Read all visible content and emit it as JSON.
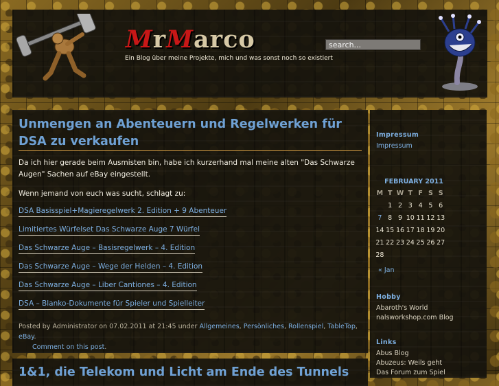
{
  "header": {
    "title_caps": [
      "M",
      "r",
      "M",
      "arco"
    ],
    "tagline": "Ein Blog über meine Projekte, mich und was sonst noch so existiert",
    "search_value": "search..."
  },
  "post": {
    "title": "Unmengen an Abenteuern und Regelwerken für DSA zu verkaufen",
    "intro": "Da ich hier gerade beim Ausmisten bin, habe ich kurzerhand mal meine alten \"Das Schwarze Augen\" Sachen auf eBay eingestellt.",
    "ask": "Wenn jemand von euch was sucht, schlagt zu:",
    "links": [
      "DSA Basisspiel+Magieregelwerk 2. Edition + 9 Abenteuer",
      "Limitiertes Würfelset Das Schwarze Auge 7 Würfel",
      "Das Schwarze Auge – Basisregelwerk – 4. Edition",
      "Das Schwarze Auge – Wege der Helden – 4. Edition",
      "Das Schwarze Auge – Liber Cantiones – 4. Edition",
      "DSA – Blanko-Dokumente für Spieler und Spielleiter"
    ],
    "meta": {
      "posted_by": "Posted by",
      "author": "Administrator",
      "on": "on",
      "date": "07.02.2011",
      "at": "at",
      "time": "21:45",
      "under": "under",
      "categories": [
        "Allgemeines",
        "Persönliches",
        "Rollenspiel",
        "TableTop",
        "eBay"
      ],
      "comment": "Comment on this post"
    }
  },
  "post2": {
    "title": "1&1, die Telekom und Licht am Ende des Tunnels"
  },
  "sidebar": {
    "impressum_heading": "Impressum",
    "impressum_link": "Impressum",
    "calendar": {
      "caption": "FEBRUARY 2011",
      "weekdays": [
        "M",
        "T",
        "W",
        "T",
        "F",
        "S",
        "S"
      ],
      "rows": [
        [
          "",
          "1",
          "2",
          "3",
          "4",
          "5",
          "6"
        ],
        [
          "7",
          "8",
          "9",
          "10",
          "11",
          "12",
          "13"
        ],
        [
          "14",
          "15",
          "16",
          "17",
          "18",
          "19",
          "20"
        ],
        [
          "21",
          "22",
          "23",
          "24",
          "25",
          "26",
          "27"
        ],
        [
          "28",
          "",
          "",
          "",
          "",
          "",
          ""
        ]
      ],
      "linked_days": [
        "7"
      ],
      "prev": "« Jan"
    },
    "hobby_heading": "Hobby",
    "hobby_items": [
      "Abaroth's World",
      "nalsworkshop.com Blog"
    ],
    "links_heading": "Links",
    "links_items": [
      "Abus Blog",
      "Abuzeus: Weils geht",
      "Das Forum zum Spiel"
    ]
  },
  "colors": {
    "link": "#7eb0e2",
    "title": "#6fa1d4",
    "logo_red": "#c81717",
    "panel": "#16130d",
    "rule": "#c89440"
  },
  "icons": [
    "hammer-warrior-figurine-icon",
    "blue-beholder-figurine-icon"
  ]
}
